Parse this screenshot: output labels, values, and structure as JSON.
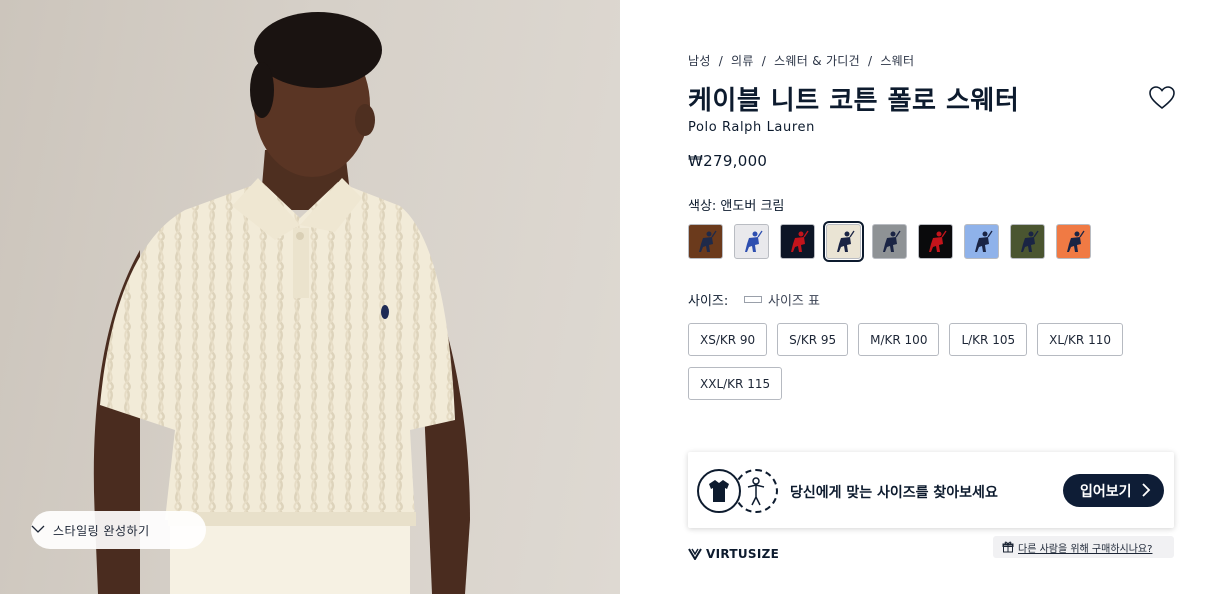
{
  "hero": {
    "style_button_label": "스타일링  완성하기"
  },
  "breadcrumb": [
    "남성",
    "의류",
    "스웨터 & 가디건",
    "스웨터"
  ],
  "product": {
    "title": "케이블 니트 코튼 폴로 스웨터",
    "brand": "Polo Ralph Lauren",
    "price": "₩279,000",
    "color_label": "색상: 앤도버 크림"
  },
  "swatches": [
    {
      "name": "brown",
      "bg": "#6b3a1c",
      "pony": "#1f2a4a",
      "selected": false
    },
    {
      "name": "white",
      "bg": "#e9e9ec",
      "pony": "#2e4fb0",
      "selected": false
    },
    {
      "name": "navy",
      "bg": "#0d1526",
      "pony": "#c4141b",
      "selected": false
    },
    {
      "name": "cream",
      "bg": "#eae4d4",
      "pony": "#1a2444",
      "selected": true
    },
    {
      "name": "grey",
      "bg": "#8e9295",
      "pony": "#1a2444",
      "selected": false
    },
    {
      "name": "black",
      "bg": "#0a0a0c",
      "pony": "#c4141b",
      "selected": false
    },
    {
      "name": "light-blue",
      "bg": "#8fb2ea",
      "pony": "#1a2444",
      "selected": false
    },
    {
      "name": "olive",
      "bg": "#4a5530",
      "pony": "#1a2444",
      "selected": false
    },
    {
      "name": "orange",
      "bg": "#f07a44",
      "pony": "#1a2444",
      "selected": false
    }
  ],
  "size": {
    "label": "사이즈:",
    "chart_label": "사이즈 표",
    "options": [
      "XS/KR 90",
      "S/KR 95",
      "M/KR 100",
      "L/KR 105",
      "XL/KR 110",
      "XXL/KR 115"
    ]
  },
  "virtusize": {
    "prompt": "당신에게 맞는 사이즈를 찾아보세요",
    "button_label": "입어보기",
    "logo_text": "VIRTUSIZE",
    "gift_link": "다른 사람을 위해 구매하시나요?"
  },
  "colors": {
    "navy": "#0d1b2e",
    "sweater": "#f3ecd9"
  }
}
